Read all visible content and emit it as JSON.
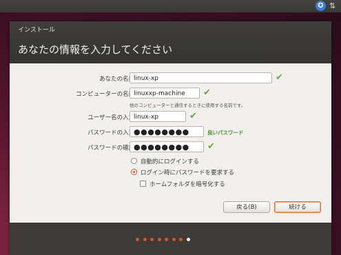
{
  "panel": {
    "accessibility_icon": "accessibility-icon",
    "network_icon": "network-arrows-icon",
    "network_glyph": "⇅",
    "accessibility_glyph": "✪"
  },
  "window": {
    "title": "インストール",
    "heading": "あなたの情報を入力してください"
  },
  "form": {
    "name_label": "あなたの名前:",
    "name_value": "linux-xp",
    "computer_label": "コンピューターの名前:",
    "computer_value": "linuxxp-machine",
    "computer_hint": "他のコンピューターと通信するときに使用する名前です。",
    "user_label": "ユーザー名の入力:",
    "user_value": "linux-xp",
    "password_label": "パスワードの入力:",
    "password_value": "●●●●●●●●",
    "password_strength": "良いパスワード",
    "confirm_label": "パスワードの確認:",
    "confirm_value": "●●●●●●●●",
    "check_mark": "✔"
  },
  "options": {
    "auto_login": "自動的にログインする",
    "require_password": "ログイン時にパスワードを要求する",
    "encrypt_home": "ホームフォルダを暗号化する",
    "selected": "require_password"
  },
  "buttons": {
    "back": "戻る(B)",
    "continue": "続ける"
  },
  "progress": {
    "total_steps": 8,
    "current_step": 8
  },
  "colors": {
    "accent": "#d9541e",
    "check": "#6aa63c",
    "strength": "#4a8a2a"
  }
}
